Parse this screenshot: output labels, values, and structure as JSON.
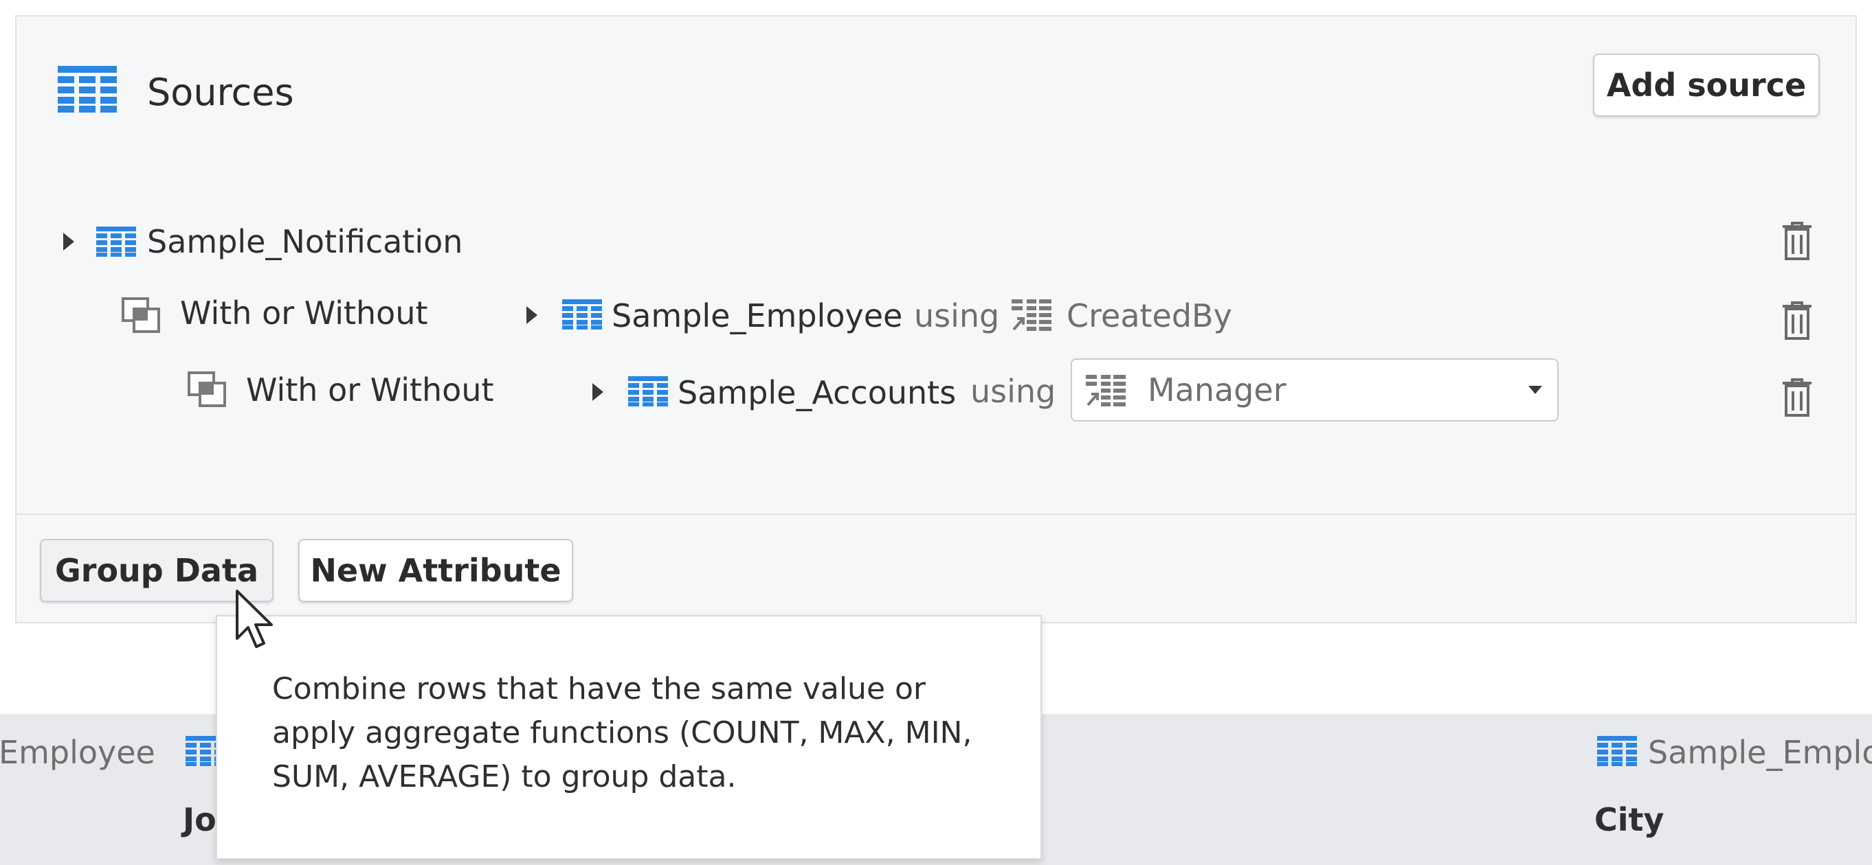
{
  "sources_panel": {
    "title": "Sources",
    "add_source_label": "Add source",
    "tree": {
      "root": {
        "name": "Sample_Notification"
      },
      "joins": [
        {
          "join_type": "With or Without",
          "source": "Sample_Employee",
          "using_label": "using",
          "key": "CreatedBy"
        },
        {
          "join_type": "With or Without",
          "source": "Sample_Accounts",
          "using_label": "using",
          "key": "Manager"
        }
      ]
    },
    "footer": {
      "group_data_label": "Group Data",
      "new_attribute_label": "New Attribute"
    }
  },
  "tooltip": {
    "text": "Combine rows that have the same value or apply aggregate functions (COUNT, MAX, MIN, SUM, AVERAGE) to group data."
  },
  "background_grid": {
    "left_source": "Employee",
    "left_column": "Jo",
    "right_source": "Sample_Emplo",
    "right_column": "City"
  },
  "colors": {
    "accent": "#2a86e0",
    "panel_bg": "#f6f7f9",
    "grid_strip_bg": "#e8e9ec"
  },
  "icons": {
    "sources": "grid-icon",
    "attribute": "attribute-icon",
    "join": "join-icon",
    "delete": "trash-icon",
    "expand": "caret-right-icon",
    "dropdown": "chevron-down-icon"
  }
}
